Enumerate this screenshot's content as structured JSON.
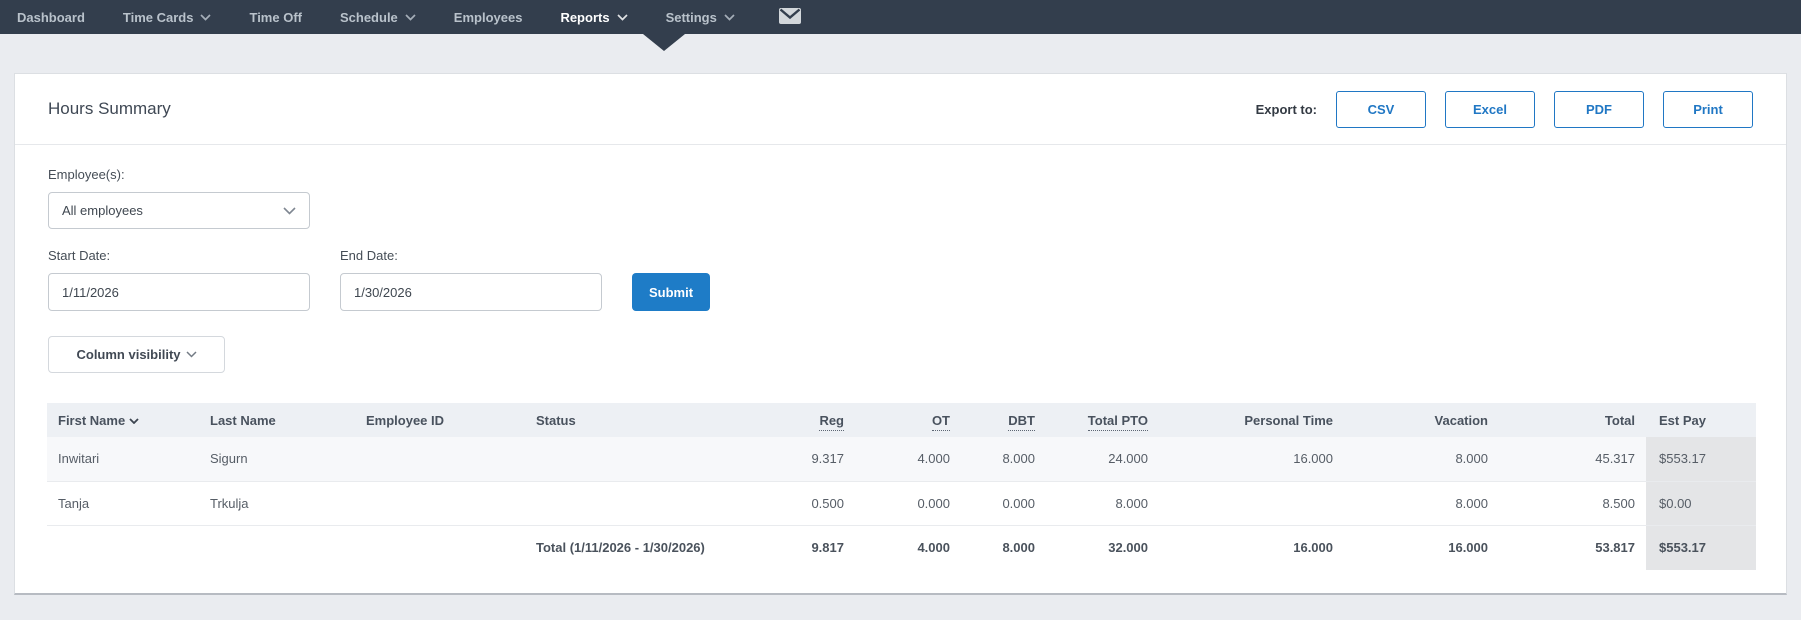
{
  "nav": {
    "items": [
      {
        "label": "Dashboard",
        "has_dropdown": false,
        "active": false
      },
      {
        "label": "Time Cards",
        "has_dropdown": true,
        "active": false
      },
      {
        "label": "Time Off",
        "has_dropdown": false,
        "active": false
      },
      {
        "label": "Schedule",
        "has_dropdown": true,
        "active": false
      },
      {
        "label": "Employees",
        "has_dropdown": false,
        "active": false
      },
      {
        "label": "Reports",
        "has_dropdown": true,
        "active": true
      },
      {
        "label": "Settings",
        "has_dropdown": true,
        "active": false
      }
    ],
    "mail_icon": "envelope-icon",
    "colors": {
      "bar": "#333e4d",
      "text": "#b9c2cb",
      "active_text": "#ffffff"
    }
  },
  "report": {
    "title": "Hours Summary",
    "export_label": "Export to:",
    "export_buttons": [
      "CSV",
      "Excel",
      "PDF",
      "Print"
    ],
    "accent_color": "#1e7cc7"
  },
  "filters": {
    "employees_label": "Employee(s):",
    "employees_value": "All employees",
    "start_date_label": "Start Date:",
    "start_date_value": "1/11/2026",
    "end_date_label": "End Date:",
    "end_date_value": "1/30/2026",
    "submit_label": "Submit",
    "column_visibility_label": "Column visibility"
  },
  "table": {
    "columns": [
      {
        "label": "First Name",
        "sortable": true,
        "tooltip_underline": false
      },
      {
        "label": "Last Name",
        "sortable": false,
        "tooltip_underline": false
      },
      {
        "label": "Employee ID",
        "sortable": false,
        "tooltip_underline": false
      },
      {
        "label": "Status",
        "sortable": false,
        "tooltip_underline": false
      },
      {
        "label": "Reg",
        "sortable": false,
        "tooltip_underline": true
      },
      {
        "label": "OT",
        "sortable": false,
        "tooltip_underline": true
      },
      {
        "label": "DBT",
        "sortable": false,
        "tooltip_underline": true
      },
      {
        "label": "Total PTO",
        "sortable": false,
        "tooltip_underline": true
      },
      {
        "label": "Personal Time",
        "sortable": false,
        "tooltip_underline": false
      },
      {
        "label": "Vacation",
        "sortable": false,
        "tooltip_underline": false
      },
      {
        "label": "Total",
        "sortable": false,
        "tooltip_underline": false
      },
      {
        "label": "Est Pay",
        "sortable": false,
        "tooltip_underline": false
      }
    ],
    "rows": [
      {
        "first_name": "Inwitari",
        "last_name": "Sigurn",
        "employee_id": "",
        "status": "",
        "reg": "9.317",
        "ot": "4.000",
        "dbt": "8.000",
        "total_pto": "24.000",
        "personal_time": "16.000",
        "vacation": "8.000",
        "total": "45.317",
        "est_pay": "$553.17"
      },
      {
        "first_name": "Tanja",
        "last_name": "Trkulja",
        "employee_id": "",
        "status": "",
        "reg": "0.500",
        "ot": "0.000",
        "dbt": "0.000",
        "total_pto": "8.000",
        "personal_time": "",
        "vacation": "8.000",
        "total": "8.500",
        "est_pay": "$0.00"
      }
    ],
    "total_row": {
      "label": "Total (1/11/2026 - 1/30/2026)",
      "reg": "9.817",
      "ot": "4.000",
      "dbt": "8.000",
      "total_pto": "32.000",
      "personal_time": "16.000",
      "vacation": "16.000",
      "total": "53.817",
      "est_pay": "$553.17"
    }
  }
}
